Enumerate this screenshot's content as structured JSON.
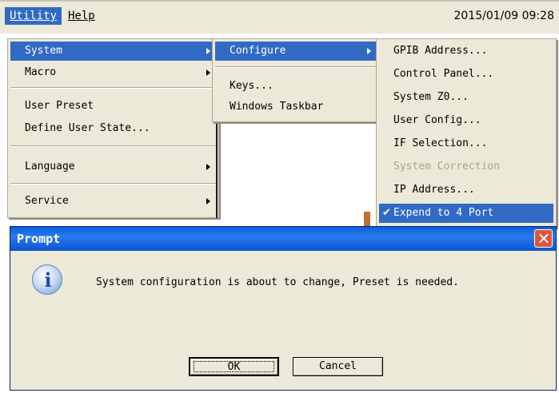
{
  "menubar": {
    "utility": "Utility",
    "help": "Help",
    "datetime": "2015/01/09 09:28"
  },
  "utility_menu": {
    "items": [
      {
        "label": "System",
        "has_submenu": true,
        "highlighted": true
      },
      {
        "label": "Macro",
        "has_submenu": true
      },
      {
        "label": "User Preset"
      },
      {
        "label": "Define User State..."
      },
      {
        "label": "Language",
        "has_submenu": true
      },
      {
        "label": "Service",
        "has_submenu": true
      }
    ]
  },
  "system_menu": {
    "items": [
      {
        "label": "Configure",
        "has_submenu": true,
        "highlighted": true
      },
      {
        "label": "Keys..."
      },
      {
        "label": "Windows Taskbar"
      }
    ]
  },
  "configure_menu": {
    "items": [
      {
        "label": "GPIB Address..."
      },
      {
        "label": "Control Panel..."
      },
      {
        "label": "System Z0..."
      },
      {
        "label": "User Config..."
      },
      {
        "label": "IF Selection..."
      },
      {
        "label": "System Correction",
        "disabled": true
      },
      {
        "label": "IP Address..."
      },
      {
        "label": "Expend to 4 Port",
        "checked": true,
        "highlighted": true
      }
    ]
  },
  "dialog": {
    "title": "Prompt",
    "message": "System configuration is about to change, Preset is needed.",
    "ok": "OK",
    "cancel": "Cancel",
    "icon": "info-icon"
  },
  "colors": {
    "highlight": "#316ac5",
    "menu_bg": "#ece9d8",
    "title_blue": "#0a5fd8",
    "close_red": "#e0553a"
  }
}
